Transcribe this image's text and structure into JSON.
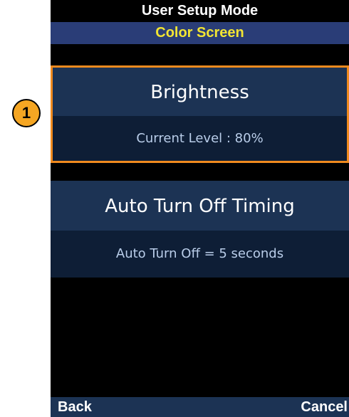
{
  "header": {
    "title": "User Setup Mode",
    "subtitle": "Color Screen"
  },
  "settings": [
    {
      "label": "Brightness",
      "value": "Current Level : 80%"
    },
    {
      "label": "Auto Turn Off Timing",
      "value": "Auto Turn Off = 5 seconds"
    }
  ],
  "softkeys": {
    "left": "Back",
    "right": "Cancel"
  },
  "callout": {
    "number": "1"
  },
  "colors": {
    "screen_background": "#000000",
    "subtitle_background": "#2a3d77",
    "subtitle_text": "#f2e533",
    "setting_header_background": "#1c3354",
    "setting_value_background": "#0e1e36",
    "highlight_border": "#f08a1e",
    "callout_fill": "#f5a623"
  }
}
